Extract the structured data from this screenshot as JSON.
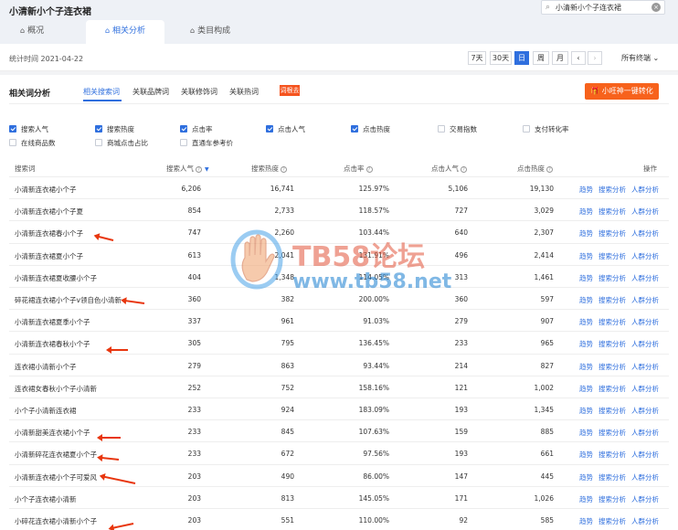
{
  "app": {
    "title": "小清新小个子连衣裙"
  },
  "search": {
    "value": "小清新小个子连衣裙"
  },
  "tabs": [
    {
      "label": "概况"
    },
    {
      "label": "相关分析"
    },
    {
      "label": "类目构成"
    }
  ],
  "date": {
    "stat_label": "统计时间 2021-04-22",
    "ranges": [
      "7天",
      "30天",
      "日",
      "周",
      "月"
    ],
    "active": "日",
    "prev": "‹",
    "next": "›",
    "terminal": "所有终端"
  },
  "section": {
    "title": "相关词分析",
    "subtabs": [
      "相关搜索词",
      "关联品牌词",
      "关联修饰词",
      "关联热词"
    ],
    "red_tag": "词根去图",
    "action_button": "小旺神一键转化"
  },
  "checkboxes": [
    {
      "label": "搜索人气",
      "checked": true
    },
    {
      "label": "搜索热度",
      "checked": true
    },
    {
      "label": "点击率",
      "checked": true
    },
    {
      "label": "点击人气",
      "checked": true
    },
    {
      "label": "点击热度",
      "checked": true
    },
    {
      "label": "交易指数",
      "checked": false
    },
    {
      "label": "支付转化率",
      "checked": false
    },
    {
      "label": "在线商品数",
      "checked": false
    },
    {
      "label": "商城点击占比",
      "checked": false
    },
    {
      "label": "直通车参考价",
      "checked": false
    }
  ],
  "table": {
    "headers": [
      "搜索词",
      "搜索人气",
      "搜索热度",
      "点击率",
      "点击人气",
      "点击热度",
      "操作"
    ],
    "ops": [
      "趋势",
      "搜索分析",
      "人群分析"
    ],
    "rows": [
      [
        "小清新连衣裙小个子",
        "6,206",
        "16,741",
        "125.97%",
        "5,106",
        "19,130"
      ],
      [
        "小清新连衣裙小个子夏",
        "854",
        "2,733",
        "118.57%",
        "727",
        "3,029"
      ],
      [
        "小清新连衣裙春小个子",
        "747",
        "2,260",
        "103.44%",
        "640",
        "2,307"
      ],
      [
        "小清新连衣裙夏小个子",
        "613",
        "2,041",
        "131.91%",
        "496",
        "2,414"
      ],
      [
        "小清新连衣裙夏收腰小个子",
        "404",
        "1,348",
        "114.05%",
        "313",
        "1,461"
      ],
      [
        "碎花裙连衣裙小个子v领自色小清新",
        "360",
        "382",
        "200.00%",
        "360",
        "597"
      ],
      [
        "小清新连衣裙夏季小个子",
        "337",
        "961",
        "91.03%",
        "279",
        "907"
      ],
      [
        "小清新连衣裙春秋小个子",
        "305",
        "795",
        "136.45%",
        "233",
        "965"
      ],
      [
        "连衣裙小清新小个子",
        "279",
        "863",
        "93.44%",
        "214",
        "827"
      ],
      [
        "连衣裙女春秋小个子小清新",
        "252",
        "752",
        "158.16%",
        "121",
        "1,002"
      ],
      [
        "小个子小清新连衣裙",
        "233",
        "924",
        "183.09%",
        "193",
        "1,345"
      ],
      [
        "小清新甜美连衣裙小个子",
        "233",
        "845",
        "107.63%",
        "159",
        "885"
      ],
      [
        "小清新碎花连衣裙夏小个子",
        "233",
        "672",
        "97.56%",
        "193",
        "661"
      ],
      [
        "小清新连衣裙小个子可爱风",
        "203",
        "490",
        "86.00%",
        "147",
        "445"
      ],
      [
        "小个子连衣裙小清新",
        "203",
        "813",
        "145.05%",
        "171",
        "1,026"
      ],
      [
        "小碎花连衣裙小清新小个子",
        "203",
        "551",
        "110.00%",
        "92",
        "585"
      ]
    ]
  },
  "watermark": {
    "brand": "TB58论坛",
    "url": "www.tb58.net"
  }
}
